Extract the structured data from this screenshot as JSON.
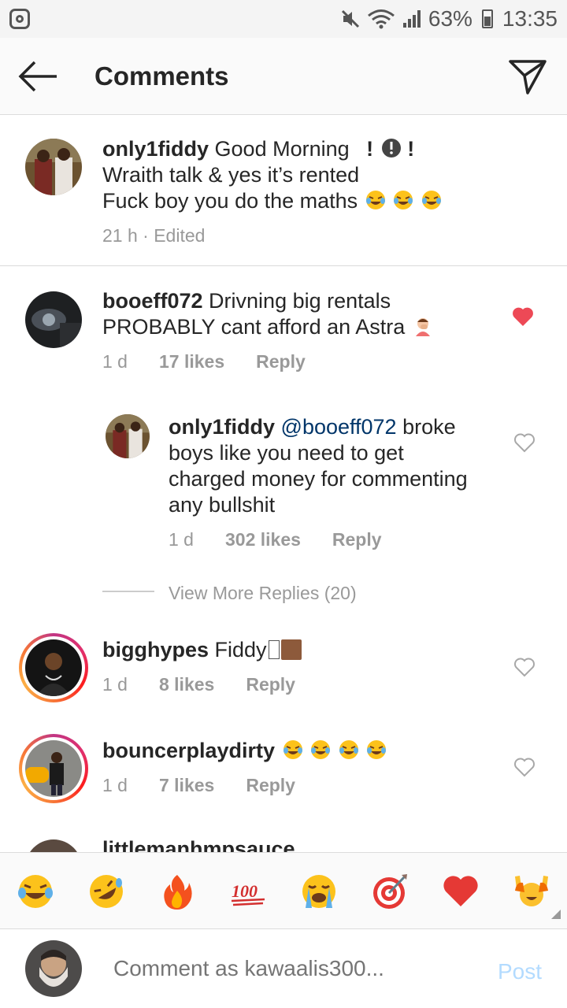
{
  "status_bar": {
    "battery": "63%",
    "time": "13:35"
  },
  "header": {
    "title": "Comments"
  },
  "comments": [
    {
      "username": "only1fiddy",
      "lines": [
        "Good Morning",
        "Wraith talk & yes it’s rented",
        "Fuck boy you do the maths"
      ],
      "time": "21 h · Edited"
    },
    {
      "username": "booeff072",
      "lines": [
        "Drivning big rentals",
        "PROBABLY cant afford an Astra"
      ],
      "time": "1 d",
      "likes": "17 likes",
      "reply": "Reply",
      "liked": true
    },
    {
      "username": "only1fiddy",
      "mention": "@booeff072",
      "lines": [
        "broke",
        "boys like you need to get",
        "charged money for commenting",
        "any bullshit"
      ],
      "time": "1 d",
      "likes": "302 likes",
      "reply": "Reply",
      "liked": false
    },
    {
      "username": "bigghypes",
      "text": "Fiddy",
      "time": "1 d",
      "likes": "8 likes",
      "reply": "Reply",
      "liked": false
    },
    {
      "username": "bouncerplaydirty",
      "time": "1 d",
      "likes": "7 likes",
      "reply": "Reply",
      "liked": false
    },
    {
      "username": "littlemanhmpsauce"
    }
  ],
  "view_more": "View More Replies (20)",
  "reactions": [
    "tears-of-joy",
    "rofl",
    "fire",
    "hundred",
    "loudly-crying",
    "direct-hit",
    "red-heart",
    "raising-hands"
  ],
  "compose": {
    "placeholder": "Comment as kawaalis300...",
    "post_label": "Post"
  },
  "colors": {
    "accent": "#ed4956",
    "link": "#003569",
    "post_disabled": "#b3dbff"
  }
}
